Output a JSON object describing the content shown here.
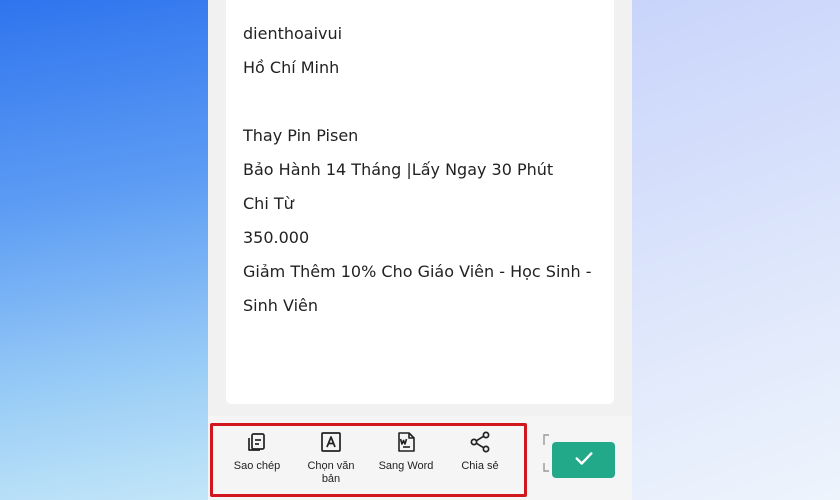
{
  "ocr_text": {
    "lines": [
      "dienthoaivui",
      "Hồ Chí Minh",
      "",
      "Thay Pin Pisen",
      "Bảo Hành 14 Tháng |Lấy Ngay 30 Phút",
      "Chi Từ",
      "350.000",
      "Giảm Thêm 10% Cho Giáo Viên - Học Sinh -",
      "Sinh Viên"
    ]
  },
  "toolbar": {
    "copy_label": "Sao chép",
    "copy_icon": "copy-icon",
    "select_label": "Chọn văn bản",
    "select_icon": "select-text-icon",
    "word_label": "Sang Word",
    "word_icon": "word-document-icon",
    "share_label": "Chia sẻ",
    "share_icon": "share-icon",
    "confirm_icon": "checkmark-icon"
  },
  "colors": {
    "confirm_button": "#21a98a",
    "highlight_border": "#d0171d"
  }
}
